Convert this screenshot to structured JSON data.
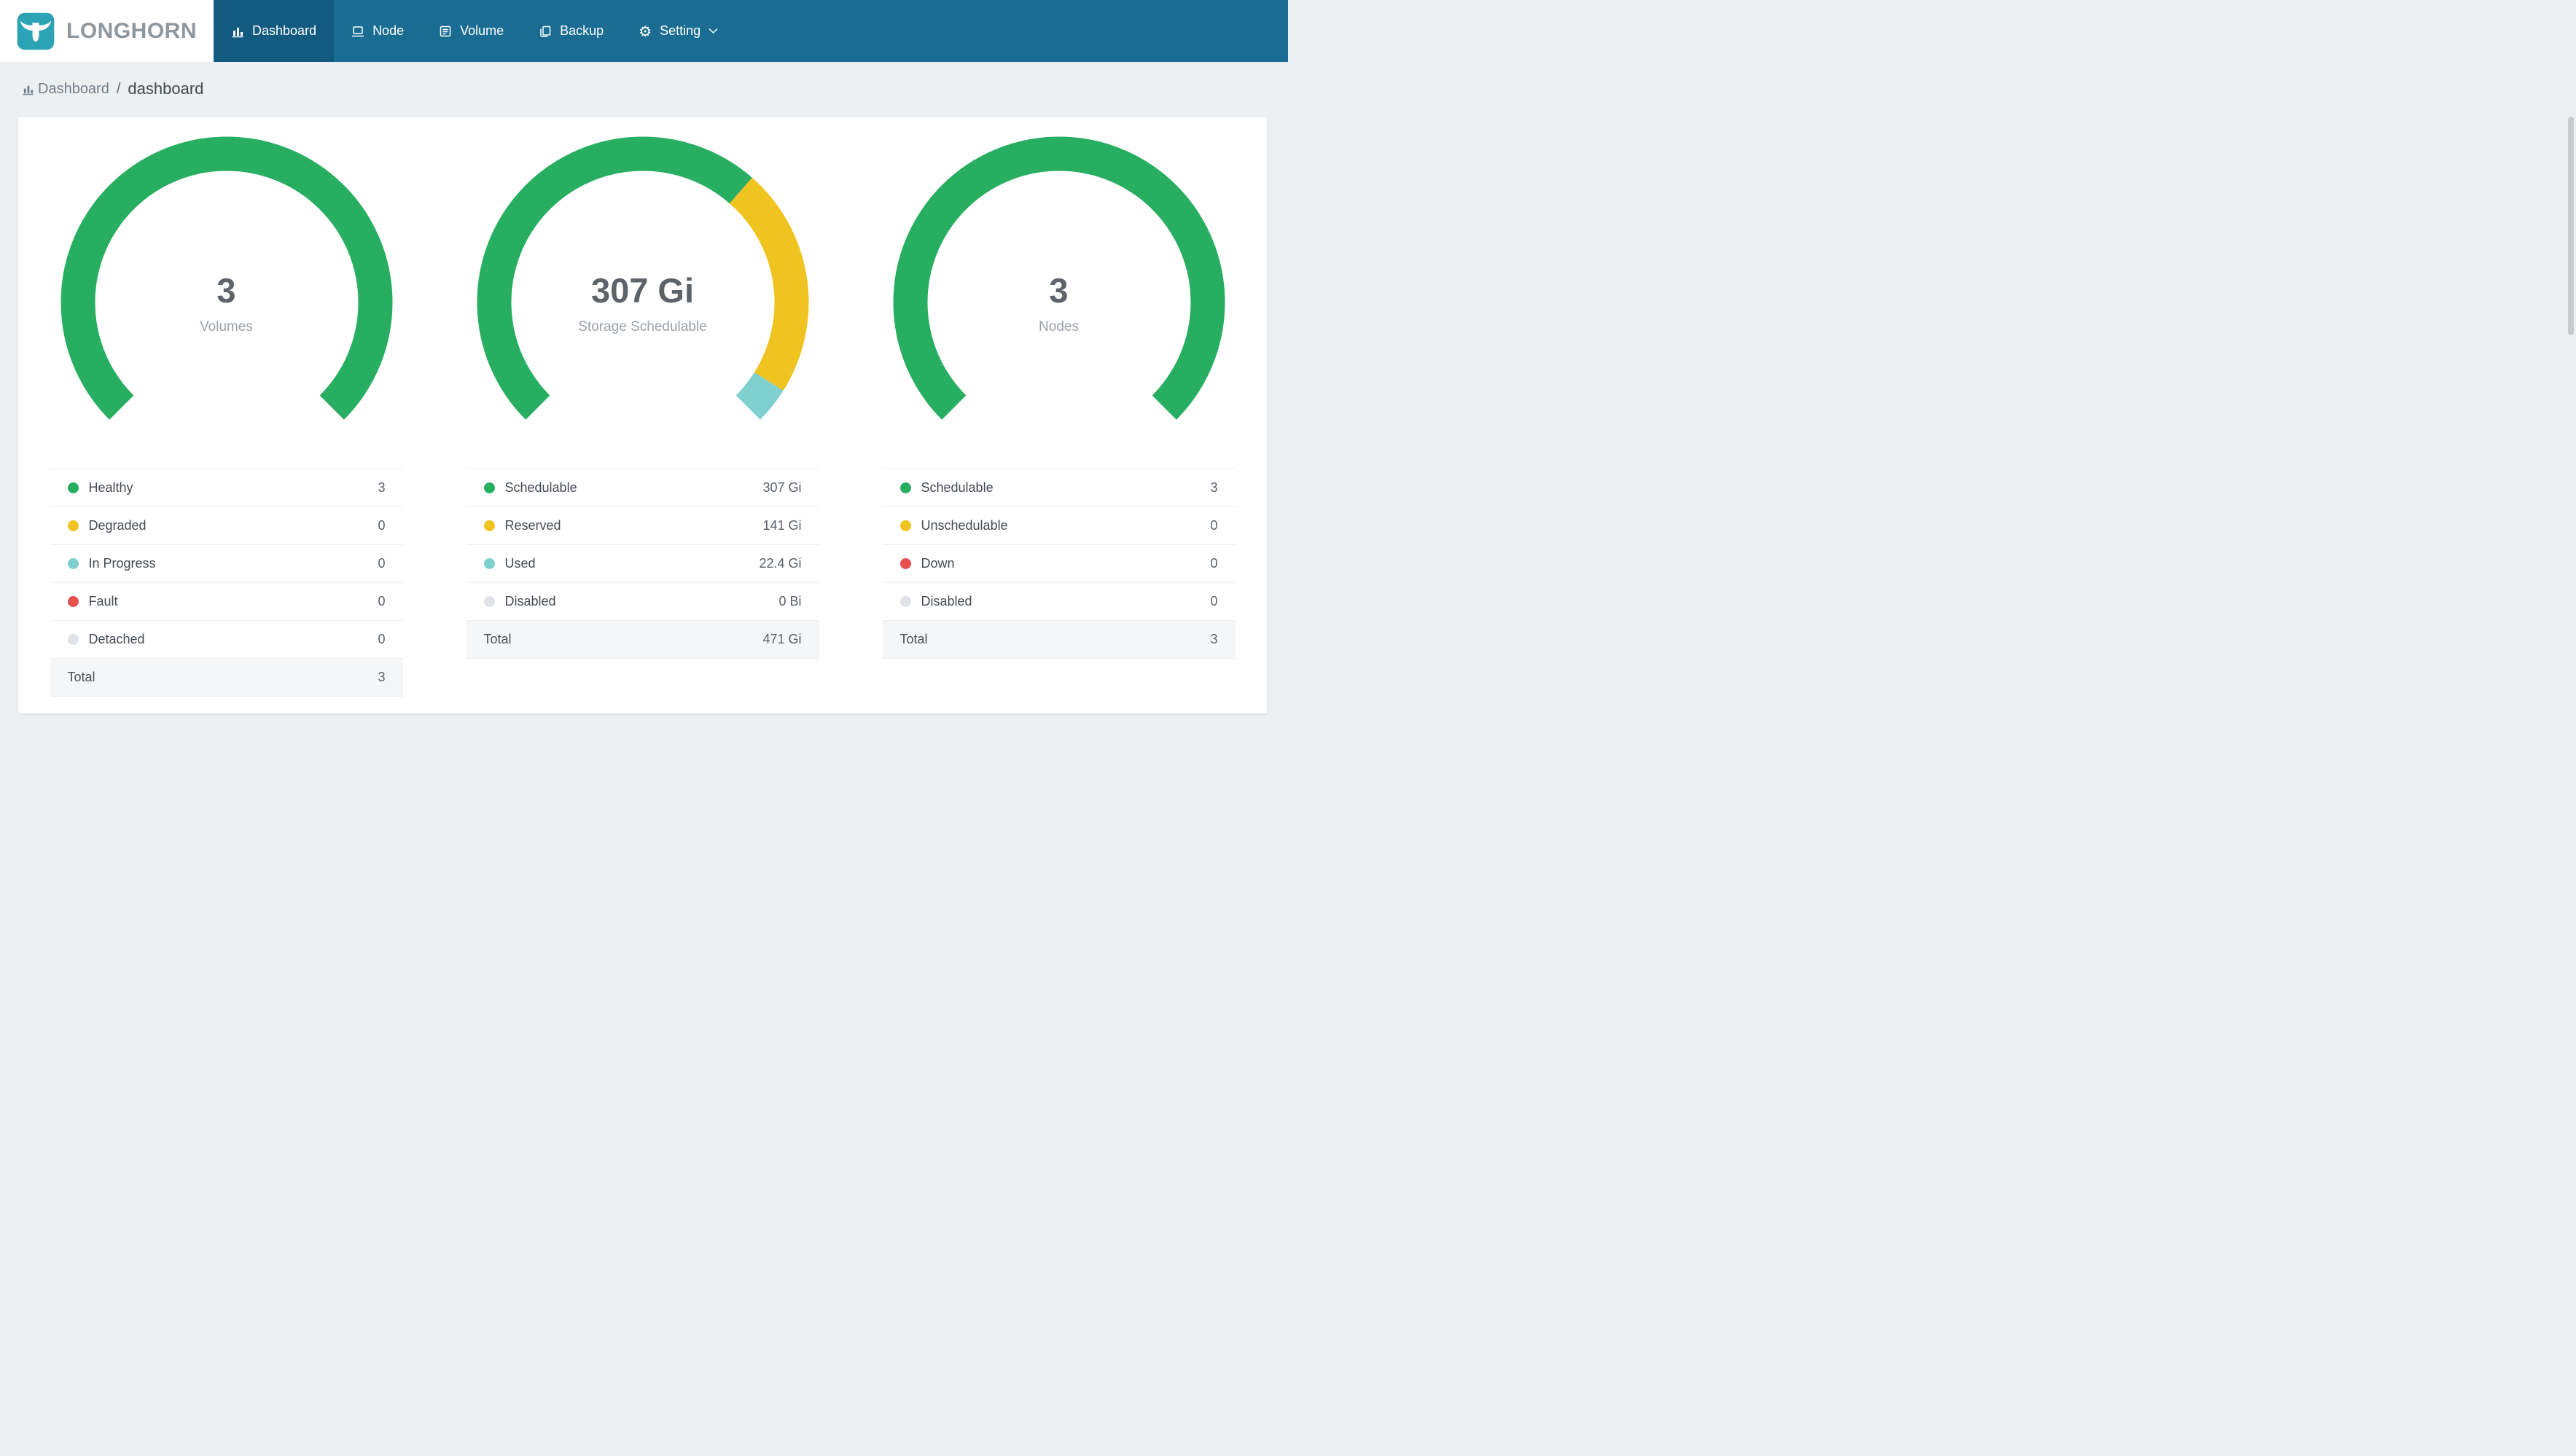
{
  "colors": {
    "green": "#27ae60",
    "yellow": "#f0c420",
    "teal": "#7fd0cf",
    "red": "#e8504f",
    "gray": "#dfe3e7",
    "navbar": "#1a6c92",
    "navbar_active": "#135a80",
    "brand_icon": "#2ba3b4"
  },
  "header": {
    "brand": "LONGHORN",
    "nav": [
      {
        "label": "Dashboard",
        "icon": "bar-chart-icon",
        "active": true
      },
      {
        "label": "Node",
        "icon": "node-icon",
        "active": false
      },
      {
        "label": "Volume",
        "icon": "volume-icon",
        "active": false
      },
      {
        "label": "Backup",
        "icon": "backup-icon",
        "active": false
      },
      {
        "label": "Setting",
        "icon": "gear-icon",
        "active": false
      }
    ]
  },
  "breadcrumb": {
    "section": "Dashboard",
    "separator": "/",
    "page": "dashboard"
  },
  "chart_data": [
    {
      "type": "gauge",
      "title": "Volumes",
      "center_value": "3",
      "center_label": "Volumes",
      "arc": {
        "start_deg": -135,
        "sweep_deg": 270
      },
      "segments": [
        {
          "label": "Healthy",
          "value": 3,
          "display": "3",
          "color": "green"
        },
        {
          "label": "Degraded",
          "value": 0,
          "display": "0",
          "color": "yellow"
        },
        {
          "label": "In Progress",
          "value": 0,
          "display": "0",
          "color": "teal"
        },
        {
          "label": "Fault",
          "value": 0,
          "display": "0",
          "color": "red"
        },
        {
          "label": "Detached",
          "value": 0,
          "display": "0",
          "color": "gray"
        }
      ],
      "total": {
        "label": "Total",
        "display": "3"
      }
    },
    {
      "type": "gauge",
      "title": "Storage Schedulable",
      "center_value": "307 Gi",
      "center_label": "Storage Schedulable",
      "arc": {
        "start_deg": -135,
        "sweep_deg": 270
      },
      "segments": [
        {
          "label": "Schedulable",
          "value": 307,
          "display": "307 Gi",
          "color": "green"
        },
        {
          "label": "Reserved",
          "value": 141,
          "display": "141 Gi",
          "color": "yellow"
        },
        {
          "label": "Used",
          "value": 22.4,
          "display": "22.4 Gi",
          "color": "teal"
        },
        {
          "label": "Disabled",
          "value": 0,
          "display": "0 Bi",
          "color": "gray"
        }
      ],
      "total": {
        "label": "Total",
        "display": "471 Gi"
      }
    },
    {
      "type": "gauge",
      "title": "Nodes",
      "center_value": "3",
      "center_label": "Nodes",
      "arc": {
        "start_deg": -135,
        "sweep_deg": 270
      },
      "segments": [
        {
          "label": "Schedulable",
          "value": 3,
          "display": "3",
          "color": "green"
        },
        {
          "label": "Unschedulable",
          "value": 0,
          "display": "0",
          "color": "yellow"
        },
        {
          "label": "Down",
          "value": 0,
          "display": "0",
          "color": "red"
        },
        {
          "label": "Disabled",
          "value": 0,
          "display": "0",
          "color": "gray"
        }
      ],
      "total": {
        "label": "Total",
        "display": "3"
      }
    }
  ]
}
